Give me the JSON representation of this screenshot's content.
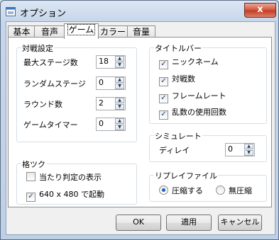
{
  "window": {
    "title": "オプション",
    "close_label": "x"
  },
  "tabs": [
    {
      "label": "基本"
    },
    {
      "label": "音声"
    },
    {
      "label": "ゲーム"
    },
    {
      "label": "カラー"
    },
    {
      "label": "音量"
    }
  ],
  "match": {
    "title": "対戦設定",
    "rows": [
      {
        "label": "最大ステージ数",
        "value": "18"
      },
      {
        "label": "ランダムステージ",
        "value": "0"
      },
      {
        "label": "ラウンド数",
        "value": "2"
      },
      {
        "label": "ゲームタイマー",
        "value": "0"
      }
    ]
  },
  "titlebar_group": {
    "title": "タイトルバー",
    "items": [
      {
        "label": "ニックネーム",
        "checked": true
      },
      {
        "label": "対戦数",
        "checked": true
      },
      {
        "label": "フレームレート",
        "checked": true
      },
      {
        "label": "乱数の使用回数",
        "checked": true
      }
    ]
  },
  "simulate": {
    "title": "シミュレート",
    "delay_label": "ディレイ",
    "delay_value": "0"
  },
  "fighter": {
    "title": "格ツク",
    "items": [
      {
        "label": "当たり判定の表示",
        "checked": false
      },
      {
        "label": "640 x 480 で起動",
        "checked": true
      }
    ]
  },
  "replay": {
    "title": "リプレイファイル",
    "options": [
      {
        "label": "圧縮する",
        "selected": true
      },
      {
        "label": "無圧縮",
        "selected": false
      }
    ]
  },
  "buttons": {
    "ok": "OK",
    "apply": "適用",
    "cancel": "キャンセル"
  },
  "glyphs": {
    "check": "✓",
    "up": "▲",
    "down": "▼"
  }
}
